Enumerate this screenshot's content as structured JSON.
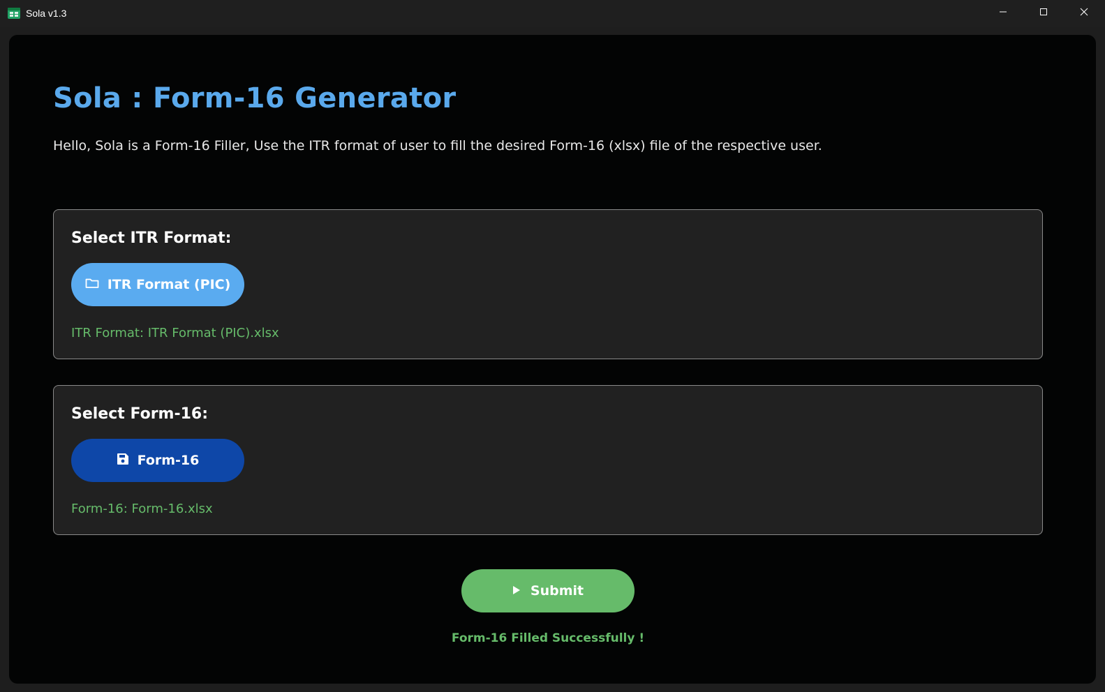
{
  "window": {
    "title": "Sola v1.3",
    "app_icon": "spreadsheet-icon",
    "controls": [
      "minimize-icon",
      "maximize-icon",
      "close-icon"
    ]
  },
  "main": {
    "title": "Sola : Form-16 Generator",
    "description": "Hello, Sola is a Form-16 Filler, Use the ITR format of user to fill the desired Form-16 (xlsx) file of the respective user."
  },
  "itr_panel": {
    "heading": "Select ITR Format:",
    "button_label": "ITR Format (PIC)",
    "button_icon": "folder-icon",
    "status": "ITR Format: ITR Format (PIC).xlsx"
  },
  "form16_panel": {
    "heading": "Select Form-16:",
    "button_label": "Form-16",
    "button_icon": "save-icon",
    "status": "Form-16: Form-16.xlsx"
  },
  "submit": {
    "label": "Submit",
    "icon": "play-icon"
  },
  "result": {
    "message": "Form-16 Filled Successfully !"
  },
  "colors": {
    "title_blue": "#5aa9ec",
    "button_light_blue": "#5aabf0",
    "button_dark_blue": "#0e47a8",
    "success_green": "#66bb6a",
    "panel_bg": "#212121",
    "content_bg": "#030404"
  }
}
